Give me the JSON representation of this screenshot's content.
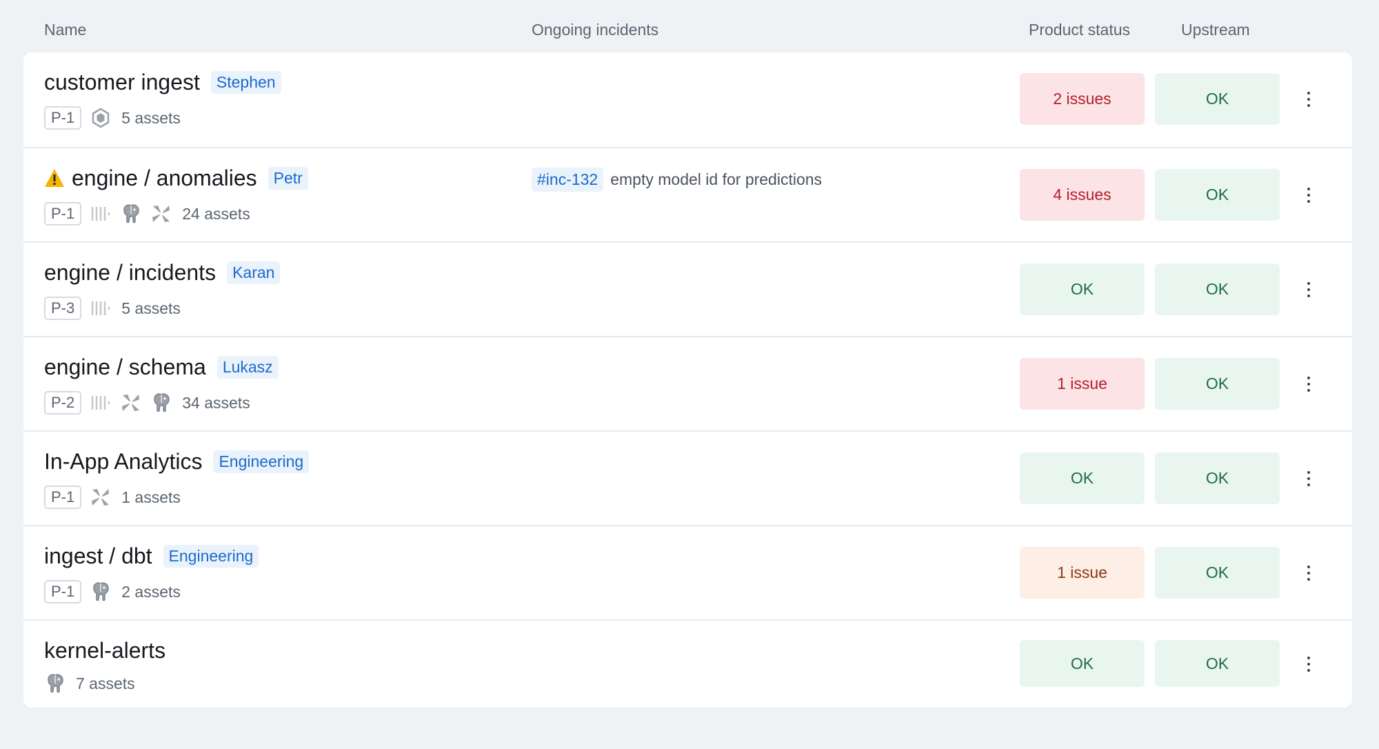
{
  "columns": {
    "name": "Name",
    "incidents": "Ongoing incidents",
    "product_status": "Product status",
    "upstream": "Upstream"
  },
  "rows": [
    {
      "name": "customer ingest",
      "owner": "Stephen",
      "priority": "P-1",
      "icons": [
        "hexagon-icon"
      ],
      "assets": "5 assets",
      "product_status": "2 issues",
      "product_status_level": "error",
      "upstream": "OK"
    },
    {
      "name": "engine / anomalies",
      "warning": true,
      "owner": "Petr",
      "priority": "P-1",
      "icons": [
        "stream-icon",
        "postgres-elephant-icon",
        "airflow-icon"
      ],
      "assets": "24 assets",
      "incident_id": "#inc-132",
      "incident_text": "empty model id for predictions",
      "product_status": "4 issues",
      "product_status_level": "error",
      "upstream": "OK"
    },
    {
      "name": "engine / incidents",
      "owner": "Karan",
      "priority": "P-3",
      "icons": [
        "stream-icon"
      ],
      "assets": "5 assets",
      "product_status": "OK",
      "product_status_level": "ok",
      "upstream": "OK"
    },
    {
      "name": "engine / schema",
      "owner": "Lukasz",
      "priority": "P-2",
      "icons": [
        "stream-icon",
        "airflow-icon",
        "postgres-elephant-icon"
      ],
      "assets": "34 assets",
      "product_status": "1 issue",
      "product_status_level": "error",
      "upstream": "OK"
    },
    {
      "name": "In-App Analytics",
      "owner": "Engineering",
      "priority": "P-1",
      "icons": [
        "airflow-icon"
      ],
      "assets": "1 assets",
      "product_status": "OK",
      "product_status_level": "ok",
      "upstream": "OK"
    },
    {
      "name": "ingest / dbt",
      "owner": "Engineering",
      "priority": "P-1",
      "icons": [
        "postgres-elephant-icon"
      ],
      "assets": "2 assets",
      "product_status": "1 issue",
      "product_status_level": "warning",
      "upstream": "OK"
    },
    {
      "name": "kernel-alerts",
      "icons": [
        "postgres-elephant-icon"
      ],
      "assets": "7 assets",
      "product_status": "OK",
      "product_status_level": "ok",
      "upstream": "OK"
    }
  ],
  "colors": {
    "ok_bg": "#e9f6f0",
    "ok_text": "#1f6b43",
    "error_bg": "#fce3e5",
    "error_text": "#b3202d",
    "warning_bg": "#fdeee6",
    "warning_text": "#8a3a12",
    "owner_text": "#1b6ac9",
    "warning_icon": "#f4b400"
  }
}
